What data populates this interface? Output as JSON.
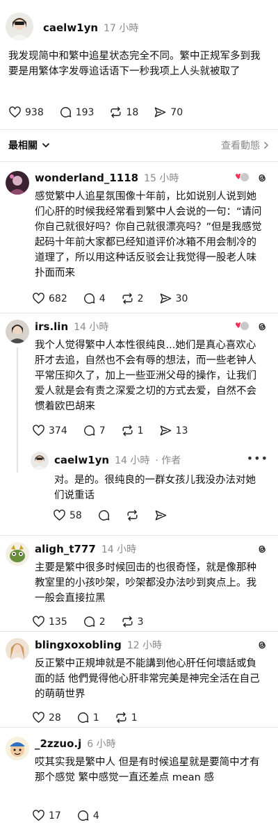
{
  "root": {
    "username": "caelw1yn",
    "time": "17 小時",
    "text": "我发现简中和繁中追星状态完全不同。繁中正规军多到我要是用繁体字发辱追话语下一秒我项上人头就被取了",
    "likes": "938",
    "comments": "193",
    "reposts": "18",
    "shares": "70"
  },
  "sort": {
    "label": "最相關",
    "view_activity": "查看動態"
  },
  "comments": [
    {
      "username": "wonderland_1118",
      "time": "15 小時",
      "text": "感觉繁中人追星氛围像十年前，比如说别人说到她们心肝的时候我经常看到繁中人会说的一句：“请问你自己就很好吗？你自己就很漂亮吗？”但是我感觉起码十年前大家都已经知道评价冰箱不用会制冷的道理了，所以用这种话反驳会让我觉得一股老人味扑面而来",
      "likes": "682",
      "comments": "4",
      "reposts": "2",
      "shares": "30"
    },
    {
      "username": "irs.lin",
      "time": "14 小時",
      "text": "我个人觉得繁中人本性很纯良...她们是真心喜欢心肝才去追，自然也不会有辱的想法，而一些老钟人平常压抑久了，加上一些亚洲父母的操作，让我们爱人就是会有责之深爱之切的方式去爱，自然不会惯着欧巴胡来",
      "likes": "374",
      "comments": "7",
      "reposts": "1",
      "shares": "13"
    },
    {
      "username": "caelw1yn",
      "time": "14 小時",
      "author_tag": "· 作者",
      "text": "对。是的。很纯良的一群女孩儿我没办法对她们说重话",
      "likes": "58"
    },
    {
      "username": "aligh_t777",
      "time": "14 小時",
      "text": "主要是繁中很多时候回击的也很奇怪，就是像那种教室里的小孩吵架，吵架都没办法吵到爽点上。我一般会直接拉黑",
      "likes": "135",
      "comments": "2",
      "reposts": "3"
    },
    {
      "username": "blingxoxobling",
      "time": "12 小時",
      "text": "反正繁中正規坤就是不能講到他心肝任何壞話或負面的話 他們覺得他心肝非常完美是神完全活在自己的萌萌世界",
      "likes": "28",
      "comments": "1",
      "reposts": "1"
    },
    {
      "username": "_2zzuo.j",
      "time": "6 小時",
      "text": "哎其实我是繁中人 但是有时候追星就是要简中才有那个感觉 繁中感觉一直还差点 mean 感",
      "likes": "17",
      "comments": "4"
    }
  ],
  "colors": {
    "muted": "#8a8a8a",
    "heart": "#ff2d55",
    "divider": "#e6e6e6"
  }
}
